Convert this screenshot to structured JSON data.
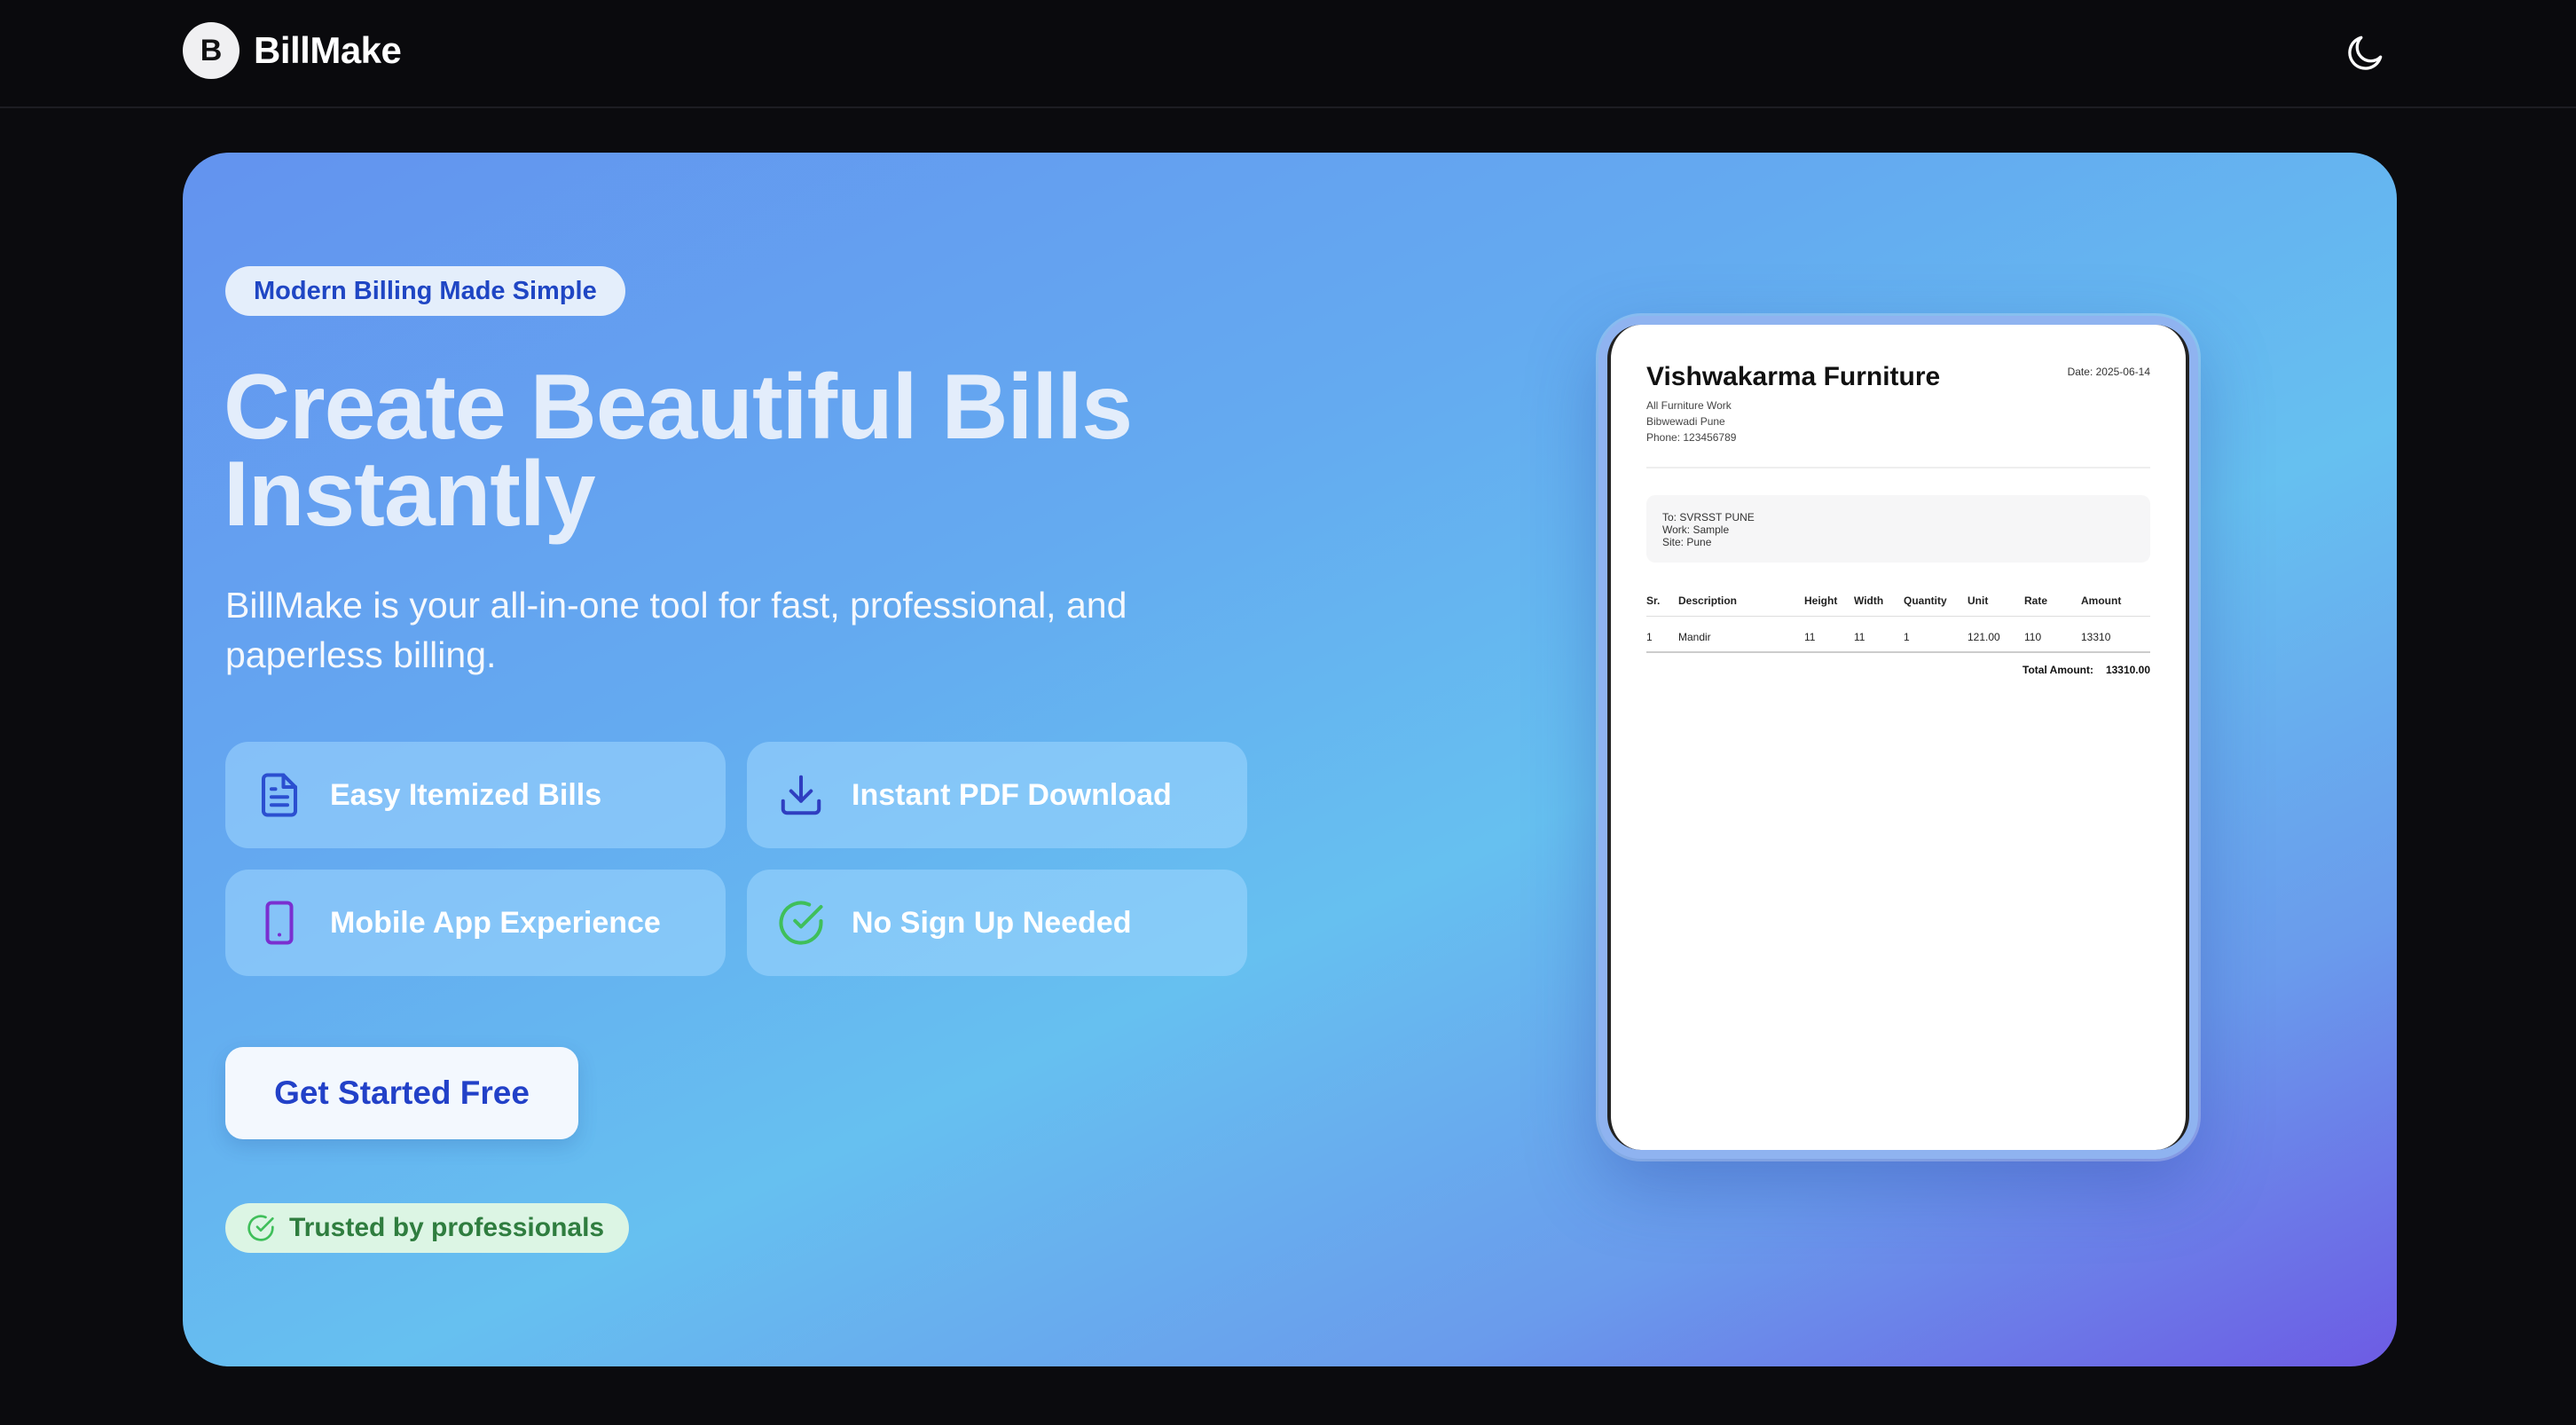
{
  "navbar": {
    "logo_letter": "B",
    "brand_name": "BillMake",
    "theme_toggle_icon": "moon-icon"
  },
  "hero": {
    "badge": "Modern Billing Made Simple",
    "headline_line1": "Create Beautiful Bills",
    "headline_line2": "Instantly",
    "subtext": "BillMake is your all-in-one tool for fast, professional, and paperless billing.",
    "features": [
      {
        "label": "Easy Itemized Bills",
        "icon": "document-icon",
        "icon_color": "#2b4fd0"
      },
      {
        "label": "Instant PDF Download",
        "icon": "download-icon",
        "icon_color": "#2f3ec0"
      },
      {
        "label": "Mobile App Experience",
        "icon": "mobile-icon",
        "icon_color": "#7a2fd0"
      },
      {
        "label": "No Sign Up Needed",
        "icon": "check-circle-icon",
        "icon_color": "#3fbf5a"
      }
    ],
    "cta_label": "Get Started Free",
    "trust_label": "Trusted by professionals"
  },
  "bill_preview": {
    "company": "Vishwakarma Furniture",
    "date": "Date: 2025-06-14",
    "address_lines": [
      "All Furniture Work",
      "Bibwewadi Pune",
      "Phone: 123456789"
    ],
    "to_lines": [
      "To: SVRSST PUNE",
      "Work: Sample",
      "Site: Pune"
    ],
    "columns": [
      "Sr.",
      "Description",
      "Height",
      "Width",
      "Quantity",
      "Unit",
      "Rate",
      "Amount"
    ],
    "rows": [
      [
        "1",
        "Mandir",
        "11",
        "11",
        "1",
        "121.00",
        "110",
        "13310"
      ]
    ],
    "total_label": "Total Amount:",
    "total_value": "13310.00"
  },
  "colors": {
    "accent": "#2241c8",
    "page_bg": "#0b0b0e",
    "success": "#3fbf5a"
  }
}
